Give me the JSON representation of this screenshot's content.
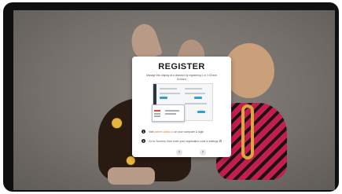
{
  "modal": {
    "title": "REGISTER",
    "description": "Manage info display at a distance by registering 1 or 2 DDeck Screens",
    "steps": [
      {
        "num": "1",
        "prefix": "Visit",
        "link": "pattern.ddeck.io",
        "suffix": "on your computer & login"
      },
      {
        "num": "2",
        "text": "Go to Screens, then enter your registration code in settings"
      }
    ],
    "prev_icon": "chevron-left-icon",
    "next_icon": "chevron-right-icon",
    "prev_glyph": "‹",
    "next_glyph": "›",
    "gear_glyph": "⚙"
  },
  "colors": {
    "accent_link": "#e57b2c",
    "preview_button": "#2f9fe0",
    "device_frame": "#0f0f0f"
  }
}
